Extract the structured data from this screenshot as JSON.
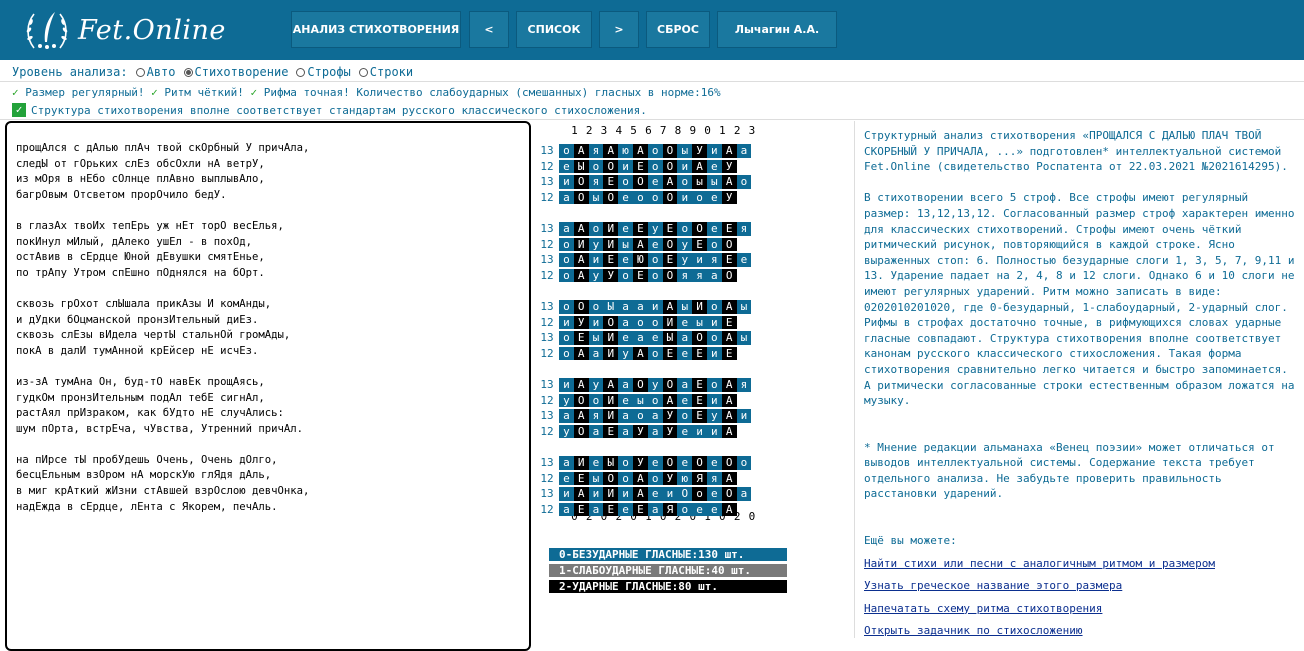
{
  "header": {
    "logo_text": "Fet.Online",
    "nav": [
      {
        "label": "АНАЛИЗ СТИХОТВОРЕНИЯ"
      },
      {
        "label": "<"
      },
      {
        "label": "СПИСОК"
      },
      {
        "label": ">"
      },
      {
        "label": "СБРОС"
      },
      {
        "label": "Лычагин А.А."
      }
    ]
  },
  "options": {
    "label": "Уровень анализа:",
    "choices": [
      {
        "label": "Авто",
        "selected": false
      },
      {
        "label": "Стихотворение",
        "selected": true
      },
      {
        "label": "Строфы",
        "selected": false
      },
      {
        "label": "Строки",
        "selected": false
      }
    ]
  },
  "status": {
    "check": "✓",
    "items": [
      "Размер регулярный!",
      "Ритм чёткий!",
      "Рифма точная! Количество слабоударных (смешанных) гласных в норме:16%"
    ],
    "structure": "Структура стихотворения вполне соответствует стандартам русского классического стихосложения."
  },
  "poem": {
    "stanzas": [
      [
        "прощАлся с дАлью плАч твой скОрбный У причАла,",
        "следЫ от гОрьких слЕз обсОхли нА ветрУ,",
        "из мОря в нЕбо сОлнце плАвно выплывАло,",
        "багрОвым Отсветом прорОчило бедУ."
      ],
      [
        "в глазАх твоИх тепЕрь уж нЕт торО весЕлья,",
        "покИнул мИлый, дАлеко ушЕл - в похОд,",
        "остАвив в сЕрдце Юной дЕвушки смятЕнье,",
        "по трАпу Утром спЕшно пОднялся на бОрт."
      ],
      [
        "сквозь грОхот слЫшала прикАзы И комАнды,",
        "и дУдки бОцманской пронзИтельный диЕз.",
        "сквозь слЕзы вИдела чертЫ стальнОй громАды,",
        "покА в далИ тумАнной крЕйсер нЕ исчЕз."
      ],
      [
        "из-зА тумАна Он, буд-тО навЕк прощАясь,",
        "гудкОм пронзИтельным подАл тебЕ сигнАл,",
        "растАял прИзраком, как бУдто нЕ случАлись:",
        "шум пОрта, встрЕча, чУвства, Утренний причАл."
      ],
      [
        "на пИрсе тЫ пробУдешь Очень, Очень дОлго,",
        "бесцЕльным взОром нА морскУю глЯдя дАль,",
        "в миг крАткий жИзни стАвшей взрОслою девчОнка,",
        "надЕжда в сЕрдце, лЕнта с Якорем, печАль."
      ]
    ]
  },
  "grid": {
    "columns": [
      "1",
      "2",
      "3",
      "4",
      "5",
      "6",
      "7",
      "8",
      "9",
      "0",
      "1",
      "2",
      "3"
    ],
    "stanzas": [
      [
        {
          "n": "13",
          "letters": "оАяАюАоОыУиАа",
          "types": "0202020202020"
        },
        {
          "n": "12",
          "letters": "еЫоОиЕоОиАеУ",
          "types": "020202020202"
        },
        {
          "n": "13",
          "letters": "иОяЕоОеАоыыАо",
          "types": "0202020202020"
        },
        {
          "n": "12",
          "letters": "аОыОеооОиоеУ",
          "types": "020200020002"
        }
      ],
      [
        {
          "n": "13",
          "letters": "аАоИеЕуЕоОеЕя",
          "types": "0202020202020"
        },
        {
          "n": "12",
          "letters": "оИуИыАеОуЕоО",
          "types": "020202020202"
        },
        {
          "n": "13",
          "letters": "оАиЕеЮоЕуияЕе",
          "types": "0202020200020"
        },
        {
          "n": "12",
          "letters": "оАуУоЕоОяяаО",
          "types": "020202020002"
        }
      ],
      [
        {
          "n": "13",
          "letters": "оОоЫааиАыИоАы",
          "types": "0200000202020"
        },
        {
          "n": "12",
          "letters": "иУиОаооИеыиЕ",
          "types": "020200020002"
        },
        {
          "n": "13",
          "letters": "оЕыИеаеЫаОоАы",
          "types": "0202000202020"
        },
        {
          "n": "12",
          "letters": "оАаИуАоЕеЕиЕ",
          "types": "020202020202"
        }
      ],
      [
        {
          "n": "13",
          "letters": "иАуАаОуОаЕоАя",
          "types": "0202020202020"
        },
        {
          "n": "12",
          "letters": "уОоИеыоАеЕиА",
          "types": "020200020202"
        },
        {
          "n": "13",
          "letters": "аАяИаоаУоЕуАи",
          "types": "0202000202020"
        },
        {
          "n": "12",
          "letters": "уОаЕаУаУеииА",
          "types": "020202020002"
        }
      ],
      [
        {
          "n": "13",
          "letters": "аИеЫоУеОеОеОо",
          "types": "0202020202020"
        },
        {
          "n": "12",
          "letters": "еЕыОоАоУюЯяА",
          "types": "020202020202"
        },
        {
          "n": "13",
          "letters": "иАиИиАеиОоеОа",
          "types": "0202020002020"
        },
        {
          "n": "12",
          "letters": "аЕаЕеЕаЯоееА",
          "types": "020202020002"
        }
      ]
    ],
    "rhythm": [
      "0",
      "2",
      "0",
      "2",
      "0",
      "1",
      "0",
      "2",
      "0",
      "1",
      "0",
      "2",
      "0"
    ]
  },
  "legend": [
    {
      "text": "0-БЕЗУДАРНЫЕ ГЛАСНЫЕ:130 шт.",
      "color": "#0e6b95"
    },
    {
      "text": "1-СЛАБОУДАРНЫЕ ГЛАСНЫЕ:40 шт.",
      "color": "#7a7a7a"
    },
    {
      "text": "2-УДАРНЫЕ ГЛАСНЫЕ:80 шт.",
      "color": "#000000"
    }
  ],
  "right": {
    "intro": "Структурный анализ стихотворения «ПРОЩАЛСЯ С ДАЛЬЮ ПЛАЧ ТВОЙ СКОРБНЫЙ У ПРИЧАЛА, ...» подготовлен* интеллектуальной системой Fet.Online (свидетельство Роспатента от 22.03.2021 №2021614295).",
    "body": "В стихотворении всего 5 строф. Все строфы имеют регулярный размер: 13,12,13,12. Согласованный размер строф характерен именно для классических стихотворений. Строфы имеют очень чёткий ритмический рисунок, повторяющийся в каждой строке. Ясно выраженных стоп: 6. Полностью безударные слоги 1, 3, 5, 7, 9,11 и 13. Ударение падает на 2, 4, 8 и 12 слоги. Однако 6 и 10 слоги не имеют регулярных ударений. Ритм можно записать в виде: 0202010201020, где 0-безударный, 1-слабоударный, 2-ударный слог. Рифмы в строфах достаточно точные, в рифмующихся словах ударные гласные совпадают. Структура стихотворения вполне соответствует канонам русского классического стихосложения. Такая форма стихотворения сравнительно легко читается и быстро запоминается. А ритмически согласованные строки естественным образом ложатся на музыку.",
    "note": "* Мнение редакции альманаха «Венец поэзии» может отличаться от выводов интеллектуальной системы. Содержание текста требует отдельного анализа. Не забудьте проверить правильность расстановки ударений.",
    "more_label": "Ещё вы можете:",
    "links": [
      "Найти стихи или песни с аналогичным ритмом и размером",
      "Узнать греческое название этого размера",
      "Напечатать схему ритма стихотворения",
      "Открыть задачник по стихосложению"
    ]
  },
  "colors": {
    "header": "#0e6b95",
    "unstressed": "#0e6b95",
    "weak": "#7a7a7a",
    "stressed": "#000000",
    "check": "#2aa52a"
  }
}
